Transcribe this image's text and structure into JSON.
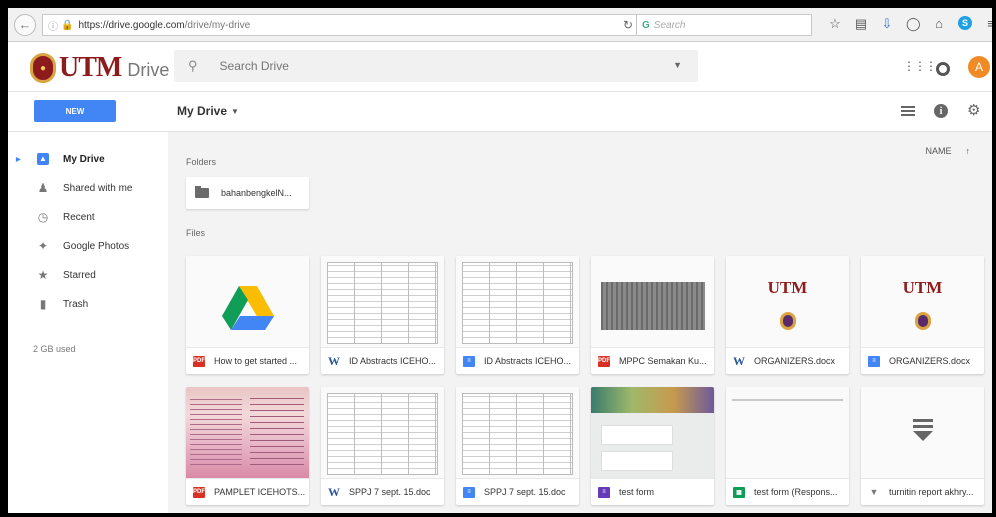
{
  "browser": {
    "url_host": "https://drive.google.com",
    "url_path": "/drive/my-drive",
    "search_placeholder": "Search"
  },
  "header": {
    "logo_text": "UTM",
    "product": "Drive",
    "search_placeholder": "Search Drive",
    "avatar_letter": "A"
  },
  "toolbar": {
    "new_label": "NEW",
    "breadcrumb": "My Drive"
  },
  "sidebar": {
    "items": [
      {
        "label": "My Drive",
        "icon": "drive-icon",
        "active": true
      },
      {
        "label": "Shared with me",
        "icon": "people-icon"
      },
      {
        "label": "Recent",
        "icon": "clock-icon"
      },
      {
        "label": "Google Photos",
        "icon": "pinwheel-icon"
      },
      {
        "label": "Starred",
        "icon": "star-icon"
      },
      {
        "label": "Trash",
        "icon": "trash-icon"
      }
    ],
    "storage": "2 GB used"
  },
  "main": {
    "folders_label": "Folders",
    "files_label": "Files",
    "sort_label": "NAME",
    "folders": [
      {
        "name": "bahanbengkelN..."
      }
    ],
    "files": [
      {
        "name": "How to get started ...",
        "type": "pdf",
        "thumb": "drive"
      },
      {
        "name": "ID Abstracts ICEHO...",
        "type": "word",
        "thumb": "grid"
      },
      {
        "name": "ID Abstracts ICEHO...",
        "type": "gdoc",
        "thumb": "grid"
      },
      {
        "name": "MPPC Semakan Ku...",
        "type": "pdf",
        "thumb": "dark"
      },
      {
        "name": "ORGANIZERS.docx",
        "type": "word",
        "thumb": "utm"
      },
      {
        "name": "ORGANIZERS.docx",
        "type": "gdoc",
        "thumb": "utm"
      },
      {
        "name": "PAMPLET ICEHOTS...",
        "type": "pdf",
        "thumb": "pamphlet"
      },
      {
        "name": "SPPJ 7 sept. 15.doc",
        "type": "word",
        "thumb": "grid"
      },
      {
        "name": "SPPJ 7 sept. 15.doc",
        "type": "gdoc",
        "thumb": "grid"
      },
      {
        "name": "test form",
        "type": "gform",
        "thumb": "form"
      },
      {
        "name": "test form (Respons...",
        "type": "gsheet",
        "thumb": "lines"
      },
      {
        "name": "turnitin report akhry...",
        "type": "generic",
        "thumb": "arrow"
      }
    ]
  },
  "colors": {
    "accent": "#4285f4",
    "utm_maroon": "#8e1b1b",
    "avatar": "#f08a24"
  }
}
